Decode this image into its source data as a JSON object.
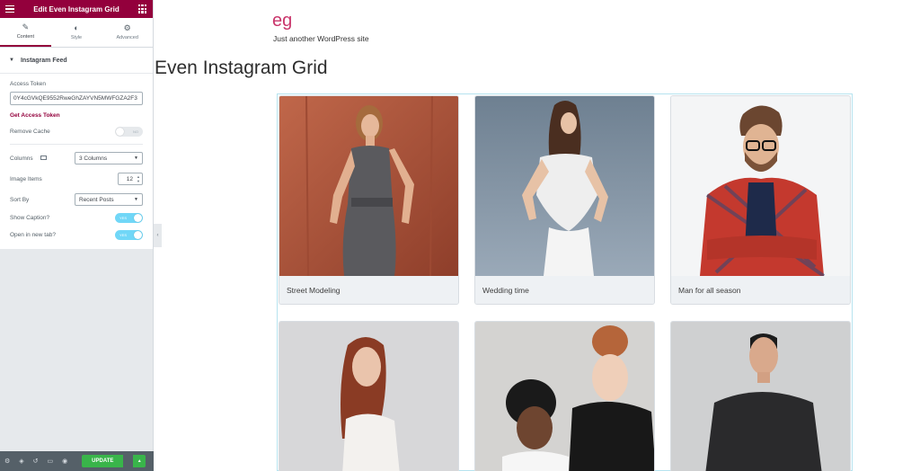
{
  "panel": {
    "title": "Edit Even Instagram Grid",
    "tabs": [
      {
        "label": "Content",
        "icon": "pencil-icon"
      },
      {
        "label": "Style",
        "icon": "half-circle-icon"
      },
      {
        "label": "Advanced",
        "icon": "gear-icon"
      }
    ],
    "section": "Instagram Feed",
    "access_token_label": "Access Token",
    "access_token_value": "0Y4cGVkQE9552RweGhZAYVN5MWFGZA2F3",
    "get_token_link": "Get Access Token",
    "remove_cache_label": "Remove Cache",
    "remove_cache_toggle": "NO",
    "columns_label": "Columns",
    "columns_value": "3 Columns",
    "image_items_label": "Image Items",
    "image_items_value": "12",
    "sort_by_label": "Sort By",
    "sort_by_value": "Recent Posts",
    "show_caption_label": "Show Caption?",
    "show_caption_toggle": "YES",
    "new_tab_label": "Open in new tab?",
    "new_tab_toggle": "YES",
    "update_label": "UPDATE"
  },
  "site": {
    "title": "eg",
    "tagline": "Just another WordPress site",
    "page_title": "Even Instagram Grid"
  },
  "grid": {
    "items": [
      {
        "caption": "Street Modeling"
      },
      {
        "caption": "Wedding time"
      },
      {
        "caption": "Man for all season"
      },
      {
        "caption": ""
      },
      {
        "caption": ""
      },
      {
        "caption": ""
      }
    ]
  },
  "colors": {
    "brand": "#93003c",
    "site_title": "#c9356b",
    "toggle_on": "#71d7f7",
    "update_button": "#39b54a"
  }
}
